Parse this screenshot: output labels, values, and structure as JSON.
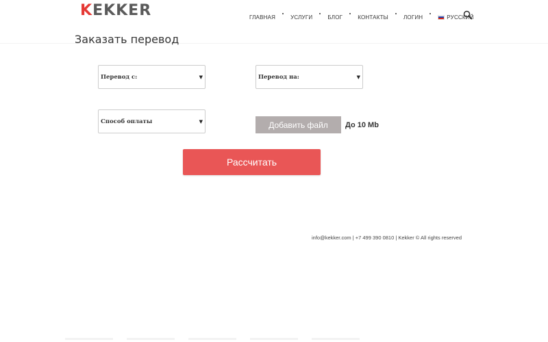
{
  "header": {
    "logo_text": "EKKER",
    "logo_initial": "K",
    "nav": [
      {
        "label": "ГЛАВНАЯ"
      },
      {
        "label": "УСЛУГИ"
      },
      {
        "label": "БЛОГ"
      },
      {
        "label": "КОНТАКТЫ"
      },
      {
        "label": "ЛОГИН"
      },
      {
        "label": "РУССКИЙ"
      }
    ],
    "search_icon": "search-icon",
    "flag_icon": "russian-flag-icon"
  },
  "page": {
    "title": "Заказать перевод"
  },
  "form": {
    "translate_from": {
      "placeholder": "Перевод с:"
    },
    "translate_to": {
      "placeholder": "Перевод на:"
    },
    "payment_method": {
      "placeholder": "Способ оплаты"
    },
    "upload_button": "Добавить файл",
    "size_limit": "До 10 Mb",
    "calculate_button": "Рассчитать"
  },
  "footer": {
    "text": "info@kekker.com | +7 499 390 0810 | Kekker © All rights reserved"
  },
  "colors": {
    "accent_red": "#e95656",
    "upload_gray": "#b3adad",
    "logo_red": "#e53935"
  }
}
